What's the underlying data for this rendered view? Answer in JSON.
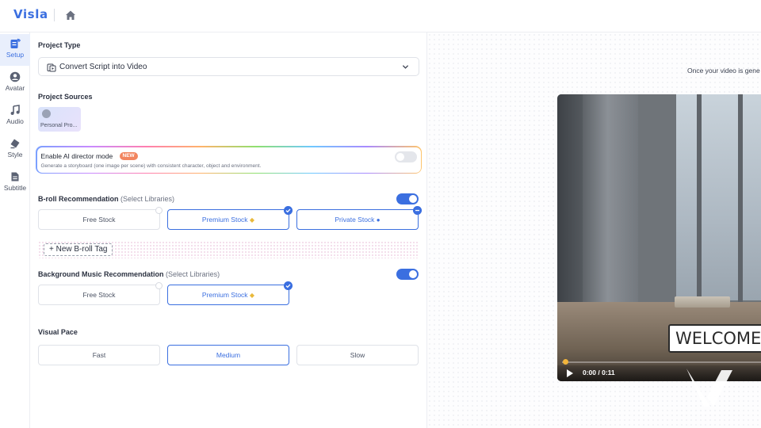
{
  "app": {
    "logo": "Visla"
  },
  "icons": {
    "home": "home-icon"
  },
  "sidebar": {
    "items": [
      {
        "label": "Setup",
        "icon": "setup-icon",
        "active": true
      },
      {
        "label": "Avatar",
        "icon": "avatar-icon",
        "active": false
      },
      {
        "label": "Audio",
        "icon": "music-note-icon",
        "active": false
      },
      {
        "label": "Style",
        "icon": "style-icon",
        "active": false
      },
      {
        "label": "Subtitle",
        "icon": "subtitle-icon",
        "active": false
      }
    ]
  },
  "form": {
    "project_type": {
      "title": "Project Type",
      "value": "Convert Script into Video",
      "icon": "script-video-icon"
    },
    "project_sources": {
      "title": "Project Sources",
      "card_label": "Personal Pro..."
    },
    "ai_director": {
      "title": "Enable AI director mode",
      "badge": "NEW",
      "description": "Generate a storyboard (one image per scene) with consistent character, object and environment.",
      "enabled": false
    },
    "broll": {
      "title": "B-roll Recommendation",
      "subtitle": "(Select Libraries)",
      "enabled": true,
      "options": [
        {
          "label": "Free Stock",
          "selected": false
        },
        {
          "label": "Premium Stock",
          "selected": true,
          "icon": "gem-icon"
        },
        {
          "label": "Private Stock",
          "selected": true,
          "icon": "person-icon"
        }
      ],
      "new_tag": "+ New B-roll Tag"
    },
    "music": {
      "title": "Background Music Recommendation",
      "subtitle": "(Select Libraries)",
      "enabled": true,
      "options": [
        {
          "label": "Free Stock",
          "selected": false
        },
        {
          "label": "Premium Stock",
          "selected": true,
          "icon": "gem-icon"
        }
      ]
    },
    "visual_pace": {
      "title": "Visual Pace",
      "options": [
        {
          "label": "Fast",
          "selected": false
        },
        {
          "label": "Medium",
          "selected": true
        },
        {
          "label": "Slow",
          "selected": false
        }
      ]
    }
  },
  "preview": {
    "note": "Once your video is gene",
    "caption": "WELCOME T",
    "time": "0:00 / 0:11",
    "progress": 0.0
  },
  "colors": {
    "accent": "#3b6fe0",
    "badge": "#f2855f",
    "premium_gem": "#e9b93b"
  }
}
